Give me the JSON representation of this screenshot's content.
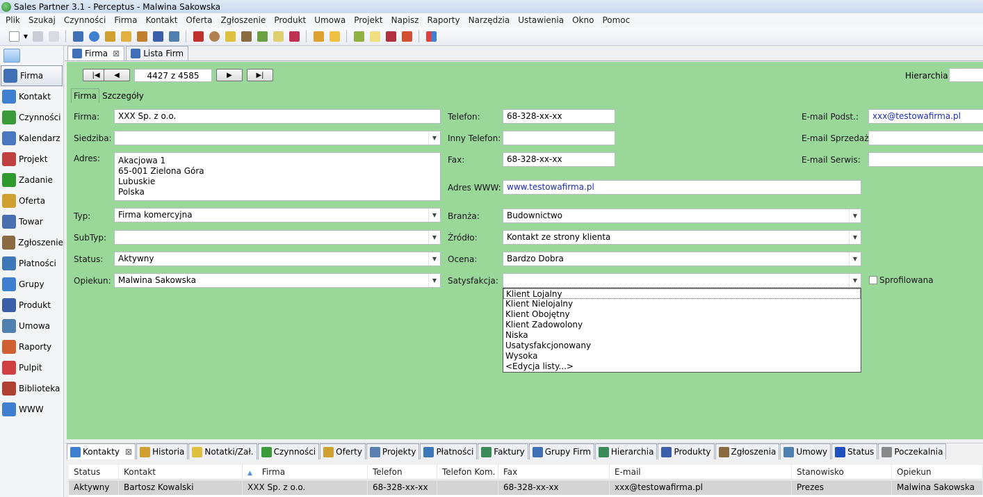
{
  "window": {
    "title": "Sales Partner 3.1 - Perceptus - Malwina Sakowska"
  },
  "menu": [
    "Plik",
    "Szukaj",
    "Czynności",
    "Firma",
    "Kontakt",
    "Oferta",
    "Zgłoszenie",
    "Produkt",
    "Umowa",
    "Projekt",
    "Napisz",
    "Raporty",
    "Narzędzia",
    "Ustawienia",
    "Okno",
    "Pomoc"
  ],
  "sidebar": {
    "items": [
      {
        "label": "Firma",
        "icon": "building-icon",
        "color": "#3f6fb5"
      },
      {
        "label": "Kontakt",
        "icon": "person-icon",
        "color": "#3f7fd0"
      },
      {
        "label": "Czynności",
        "icon": "checklist-icon",
        "color": "#3a9a3a"
      },
      {
        "label": "Kalendarz",
        "icon": "calendar-icon",
        "color": "#4a78c0"
      },
      {
        "label": "Projekt",
        "icon": "gantt-icon",
        "color": "#c04040"
      },
      {
        "label": "Zadanie",
        "icon": "task-check-icon",
        "color": "#2e9a2e"
      },
      {
        "label": "Oferta",
        "icon": "coins-icon",
        "color": "#d0a030"
      },
      {
        "label": "Towar",
        "icon": "box-icon",
        "color": "#4a6fb0"
      },
      {
        "label": "Zgłoszenie",
        "icon": "tools-icon",
        "color": "#8a6a40"
      },
      {
        "label": "Płatności",
        "icon": "dollar-icon",
        "color": "#3f78b8"
      },
      {
        "label": "Grupy",
        "icon": "group-icon",
        "color": "#3f7fd0"
      },
      {
        "label": "Produkt",
        "icon": "product-icon",
        "color": "#3a5fa8"
      },
      {
        "label": "Umowa",
        "icon": "contract-icon",
        "color": "#5080b0"
      },
      {
        "label": "Raporty",
        "icon": "bar-chart-icon",
        "color": "#d06030"
      },
      {
        "label": "Pulpit",
        "icon": "desktop-icon",
        "color": "#d04040"
      },
      {
        "label": "Biblioteka",
        "icon": "books-icon",
        "color": "#b04030"
      },
      {
        "label": "WWW",
        "icon": "globe-icon",
        "color": "#3f7fd0"
      }
    ]
  },
  "doc_tabs": [
    {
      "label": "Firma",
      "icon": "building-icon",
      "closable": true,
      "active": true
    },
    {
      "label": "Lista Firm",
      "icon": "building-icon",
      "closable": false,
      "active": false
    }
  ],
  "navigator": {
    "record": "4427 z 4585",
    "first": "|◀",
    "prev": "◀",
    "next": "▶",
    "last": "▶|"
  },
  "hierarchy": {
    "label": "Hierarchia:"
  },
  "sub_tabs": [
    "Firma",
    "Szczegóły"
  ],
  "form": {
    "firma": {
      "label": "Firma:",
      "value": "XXX Sp. z o.o."
    },
    "siedziba": {
      "label": "Siedziba:",
      "value": ""
    },
    "adres": {
      "label": "Adres:",
      "lines": [
        "Akacjowa 1",
        "65-001 Zielona Góra",
        "Lubuskie",
        "Polska"
      ]
    },
    "typ": {
      "label": "Typ:",
      "value": "Firma komercyjna"
    },
    "subtyp": {
      "label": "SubTyp:",
      "value": ""
    },
    "status": {
      "label": "Status:",
      "value": "Aktywny"
    },
    "opiekun": {
      "label": "Opiekun:",
      "value": "Malwina Sakowska"
    },
    "telefon": {
      "label": "Telefon:",
      "value": "68-328-xx-xx"
    },
    "inny_telefon": {
      "label": "Inny Telefon:",
      "value": ""
    },
    "fax": {
      "label": "Fax:",
      "value": "68-328-xx-xx"
    },
    "www": {
      "label": "Adres WWW:",
      "value": "www.testowafirma.pl"
    },
    "branza": {
      "label": "Branża:",
      "value": "Budownictwo"
    },
    "zrodlo": {
      "label": "Źródło:",
      "value": "Kontakt ze strony klienta"
    },
    "ocena": {
      "label": "Ocena:",
      "value": "Bardzo Dobra"
    },
    "satysfakcja": {
      "label": "Satysfakcja:",
      "value": ""
    },
    "email_podst": {
      "label": "E-mail Podst.:",
      "value": "xxx@testowafirma.pl"
    },
    "email_sprzedaz": {
      "label": "E-mail Sprzedaż:",
      "value": ""
    },
    "email_serwis": {
      "label": "E-mail Serwis:",
      "value": ""
    },
    "sprofilowana": {
      "label": "Sprofilowana",
      "checked": false
    }
  },
  "satysfakcja_options": [
    "Klient Lojalny",
    "Klient Nielojalny",
    "Klient Obojętny",
    "Klient Zadowolony",
    "Niska",
    "Usatysfakcjonowany",
    "Wysoka",
    "<Edycja listy...>"
  ],
  "bottom_tabs": [
    {
      "label": "Kontakty",
      "icon": "person-icon",
      "active": true,
      "closable": true
    },
    {
      "label": "Historia",
      "icon": "history-icon"
    },
    {
      "label": "Notatki/Zał.",
      "icon": "note-icon"
    },
    {
      "label": "Czynności",
      "icon": "checklist-icon"
    },
    {
      "label": "Oferty",
      "icon": "coins-icon"
    },
    {
      "label": "Projekty",
      "icon": "gantt-icon"
    },
    {
      "label": "Płatności",
      "icon": "dollar-icon"
    },
    {
      "label": "Faktury",
      "icon": "invoice-icon"
    },
    {
      "label": "Grupy Firm",
      "icon": "building-icon"
    },
    {
      "label": "Hierarchia",
      "icon": "hierarchy-icon"
    },
    {
      "label": "Produkty",
      "icon": "product-icon"
    },
    {
      "label": "Zgłoszenia",
      "icon": "tools-icon"
    },
    {
      "label": "Umowy",
      "icon": "contract-icon"
    },
    {
      "label": "Status",
      "icon": "info-icon"
    },
    {
      "label": "Poczekalnia",
      "icon": "clock-icon"
    }
  ],
  "grid": {
    "columns": [
      "Status",
      "Kontakt",
      "Firma",
      "Telefon",
      "Telefon Kom.",
      "Fax",
      "E-mail",
      "Stanowisko",
      "Opiekun"
    ],
    "rows": [
      [
        "Aktywny",
        "Bartosz Kowalski",
        "XXX Sp. z o.o.",
        "68-328-xx-xx",
        "",
        "68-328-xx-xx",
        "xxx@testowafirma.pl",
        "Prezes",
        "Malwina Sakowska"
      ]
    ]
  },
  "colors": {
    "panel": "#9ad89a",
    "link": "#1a2fb5"
  }
}
